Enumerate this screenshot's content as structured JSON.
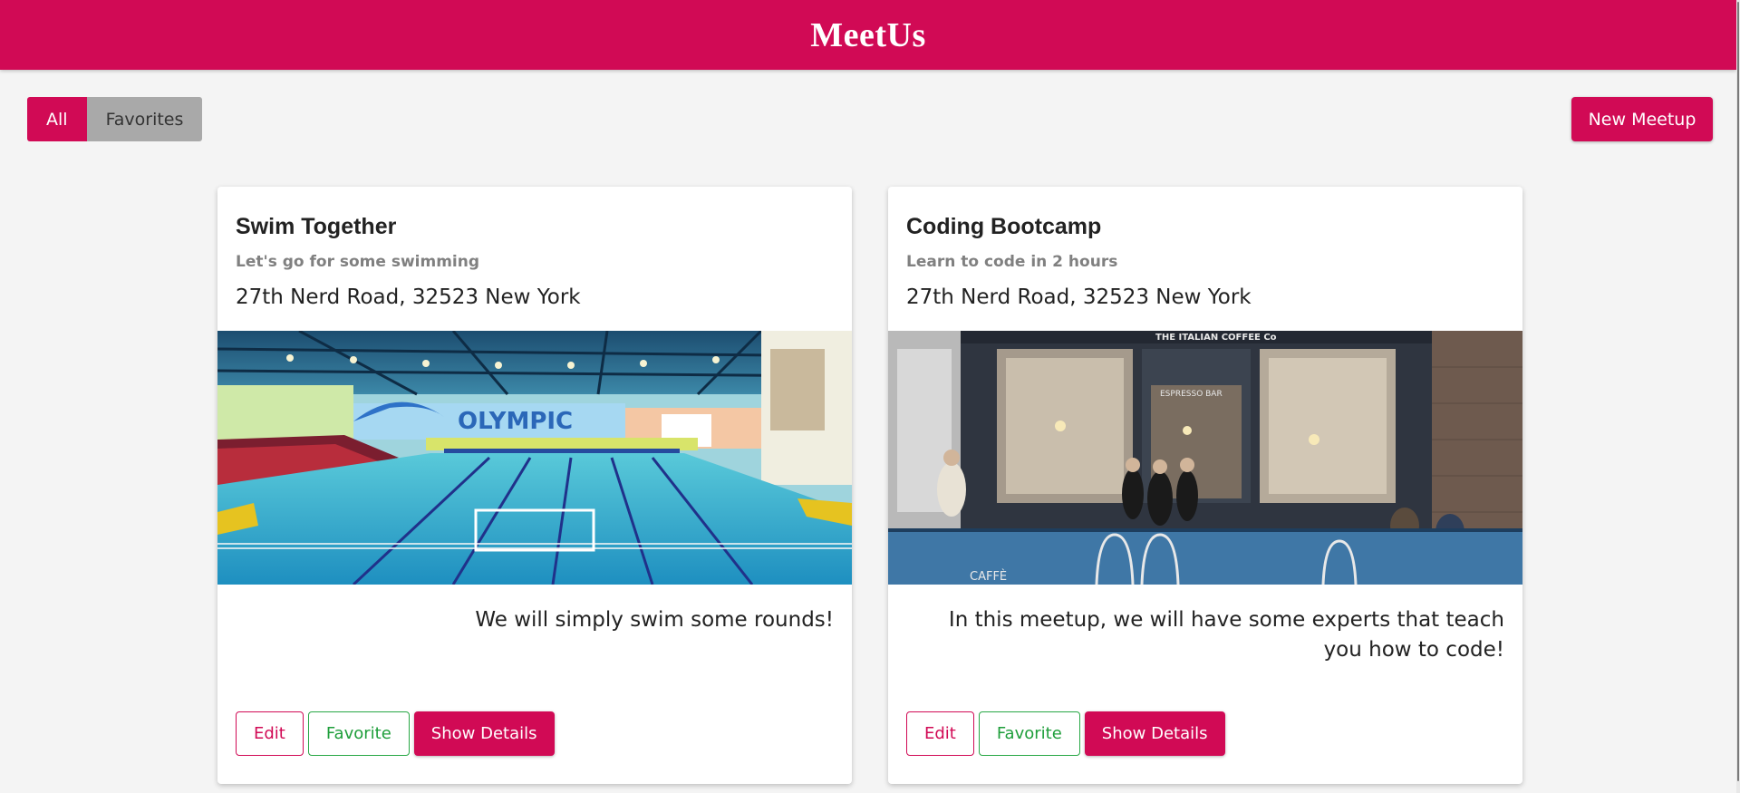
{
  "app": {
    "title": "MeetUs"
  },
  "filters": {
    "all_label": "All",
    "favorites_label": "Favorites",
    "active": "All"
  },
  "toolbar": {
    "new_meetup_label": "New Meetup"
  },
  "colors": {
    "brand": "#d10a55",
    "favorite": "#28a745",
    "inactive_filter": "#a9a9a9"
  },
  "meetups": [
    {
      "title": "Swim Together",
      "subtitle": "Let's go for some swimming",
      "address": "27th Nerd Road, 32523 New York",
      "image_alt": "indoor swimming pool",
      "image_sign": "OLYMPIC",
      "description": "We will simply swim some rounds!",
      "actions": {
        "edit": "Edit",
        "favorite": "Favorite",
        "details": "Show Details"
      }
    },
    {
      "title": "Coding Bootcamp",
      "subtitle": "Learn to code in 2 hours",
      "address": "27th Nerd Road, 32523 New York",
      "image_alt": "coffee shop storefront",
      "image_sign": "THE ITALIAN COFFEE Co",
      "image_sign_2": "ESPRESSO BAR",
      "image_sign_3": "CAFFÈ",
      "description": "In this meetup, we will have some experts that teach you how to code!",
      "actions": {
        "edit": "Edit",
        "favorite": "Favorite",
        "details": "Show Details"
      }
    }
  ]
}
